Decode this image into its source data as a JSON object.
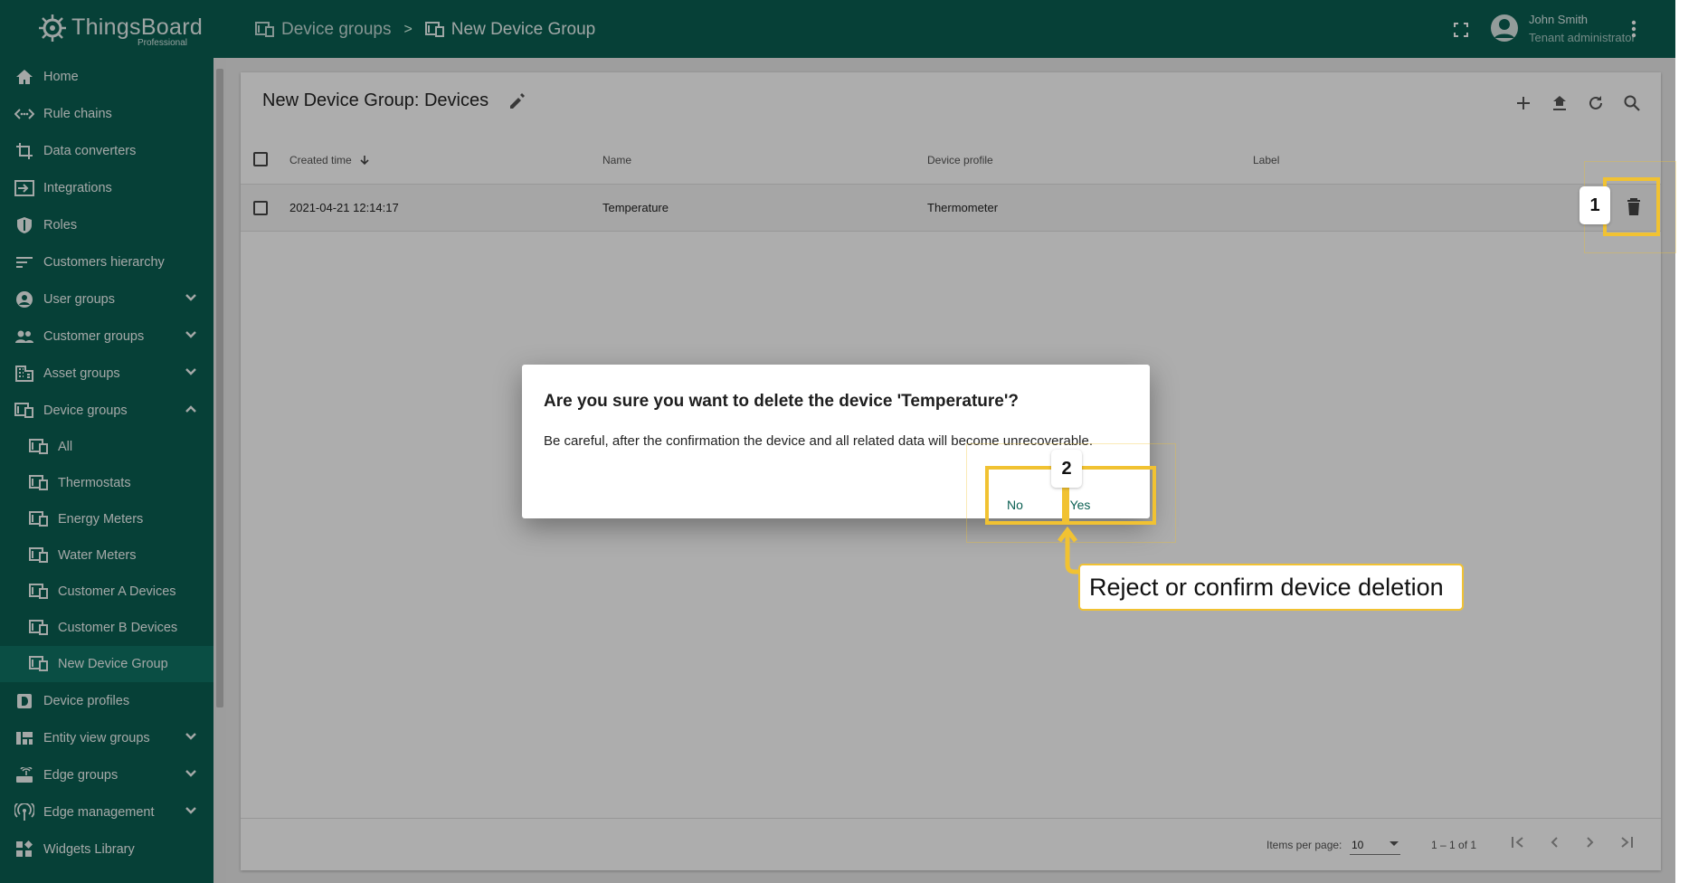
{
  "app": {
    "logo_name": "ThingsBoard",
    "logo_edition": "Professional"
  },
  "breadcrumb": {
    "items": [
      {
        "label": "Device groups",
        "icon": "devices-icon"
      },
      {
        "label": "New Device Group",
        "icon": "devices-icon"
      }
    ],
    "separator": ">"
  },
  "user": {
    "name": "John Smith",
    "role": "Tenant administrator"
  },
  "sidebar": {
    "items": [
      {
        "label": "Home",
        "icon": "home-icon"
      },
      {
        "label": "Rule chains",
        "icon": "rule-chains-icon"
      },
      {
        "label": "Data converters",
        "icon": "data-converters-icon"
      },
      {
        "label": "Integrations",
        "icon": "integrations-icon"
      },
      {
        "label": "Roles",
        "icon": "shield-icon"
      },
      {
        "label": "Customers hierarchy",
        "icon": "hierarchy-icon"
      },
      {
        "label": "User groups",
        "icon": "account-icon"
      },
      {
        "label": "Customer groups",
        "icon": "people-icon"
      },
      {
        "label": "Asset groups",
        "icon": "domain-icon"
      },
      {
        "label": "Device groups",
        "icon": "devices-icon"
      },
      {
        "label": "All",
        "icon": "devices-icon"
      },
      {
        "label": "Thermostats",
        "icon": "devices-icon"
      },
      {
        "label": "Energy Meters",
        "icon": "devices-icon"
      },
      {
        "label": "Water Meters",
        "icon": "devices-icon"
      },
      {
        "label": "Customer A Devices",
        "icon": "devices-icon"
      },
      {
        "label": "Customer B Devices",
        "icon": "devices-icon"
      },
      {
        "label": "New Device Group",
        "icon": "devices-icon"
      },
      {
        "label": "Device profiles",
        "icon": "device-profile-icon"
      },
      {
        "label": "Entity view groups",
        "icon": "view-quilt-icon"
      },
      {
        "label": "Edge groups",
        "icon": "router-icon"
      },
      {
        "label": "Edge management",
        "icon": "settings-input-antenna-icon"
      },
      {
        "label": "Widgets Library",
        "icon": "widgets-icon"
      }
    ]
  },
  "table": {
    "title": "New Device Group: Devices",
    "columns": [
      "Created time",
      "Name",
      "Device profile",
      "Label"
    ],
    "rows": [
      {
        "created": "2021-04-21 12:14:17",
        "name": "Temperature",
        "profile": "Thermometer",
        "label": ""
      }
    ],
    "pagination": {
      "items_per_page_label": "Items per page:",
      "items_per_page": "10",
      "range": "1 – 1 of 1"
    }
  },
  "dialog": {
    "title": "Are you sure you want to delete the device 'Temperature'?",
    "message": "Be careful, after the confirmation the device and all related data will become unrecoverable.",
    "no_label": "No",
    "yes_label": "Yes"
  },
  "tutorial": {
    "step1": "1",
    "step2": "2",
    "callout": "Reject or confirm device deletion",
    "highlight_color": "#f1c232"
  },
  "colors": {
    "primary": "#0a5f52",
    "accent": "#f1c232"
  }
}
